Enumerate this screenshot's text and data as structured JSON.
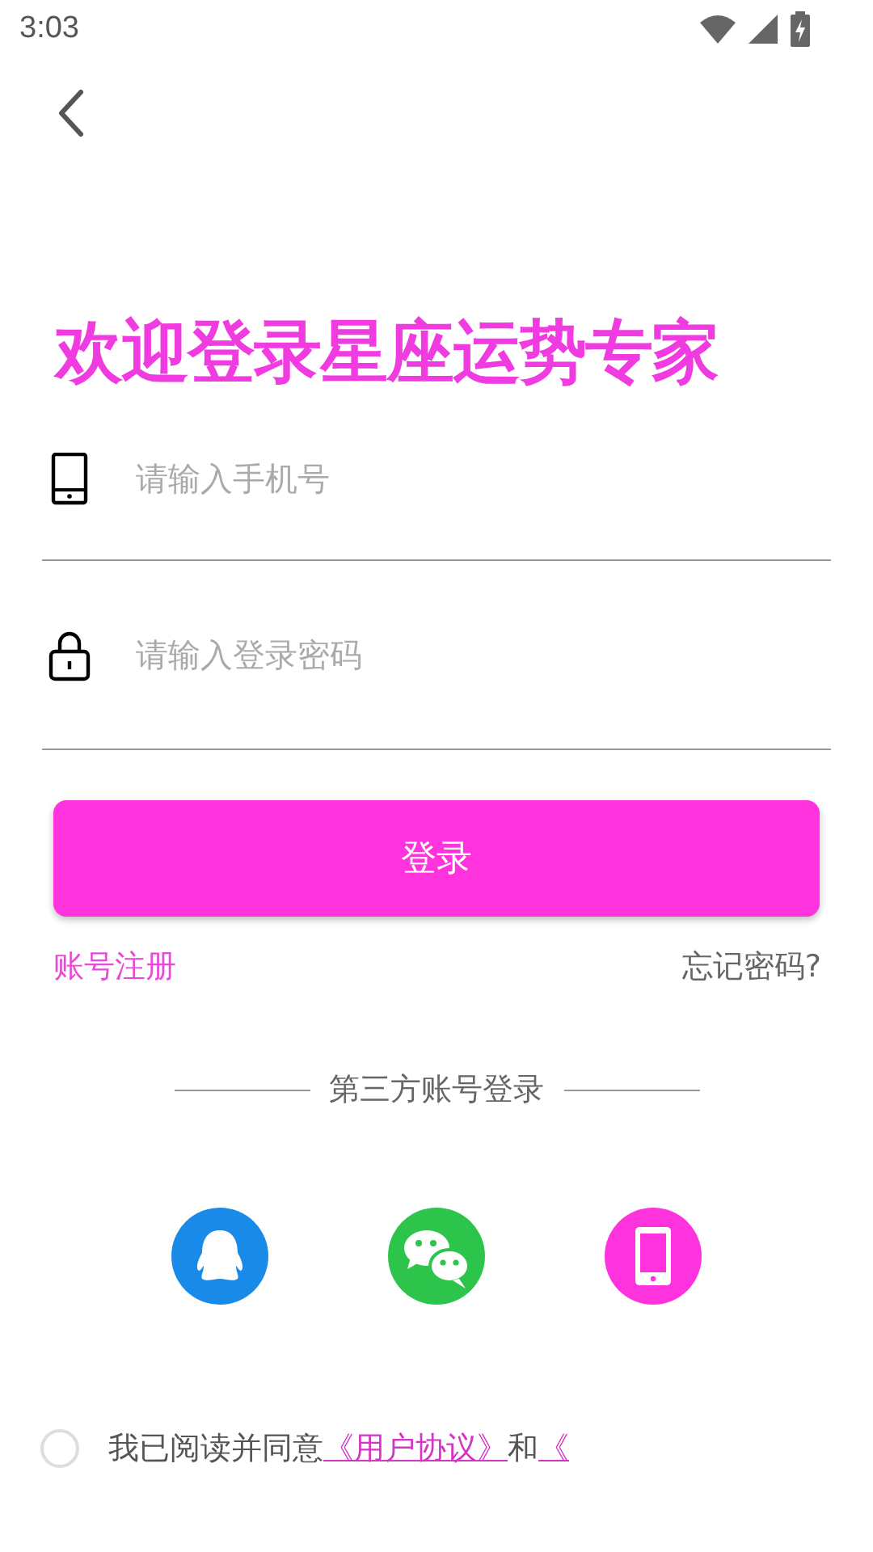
{
  "status_bar": {
    "time": "3:03"
  },
  "title": "欢迎登录星座运势专家",
  "fields": [
    {
      "kind": "phone",
      "placeholder": "请输入手机号"
    },
    {
      "kind": "lock",
      "placeholder": "请输入登录密码"
    }
  ],
  "login_button": "登录",
  "register_link": "账号注册",
  "forgot_link": "忘记密码?",
  "third_party": {
    "label": "第三方账号登录",
    "options": [
      {
        "kind": "qq"
      },
      {
        "kind": "wechat"
      },
      {
        "kind": "phone"
      }
    ]
  },
  "agreement": {
    "checked": false,
    "parts": [
      {
        "kind": "text",
        "text": "我已阅读并同意"
      },
      {
        "kind": "link",
        "text": "《用户协议》"
      },
      {
        "kind": "text",
        "text": "和"
      },
      {
        "kind": "link",
        "text": "《"
      }
    ]
  }
}
